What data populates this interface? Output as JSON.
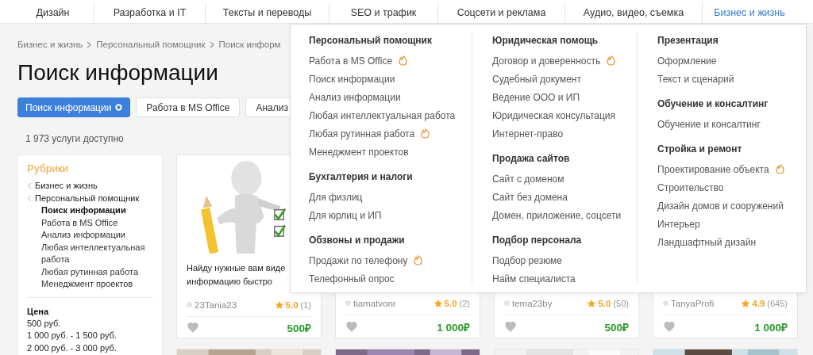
{
  "nav": [
    {
      "label": "Дизайн",
      "selected": false
    },
    {
      "label": "Разработка и IT",
      "selected": false
    },
    {
      "label": "Тексты и переводы",
      "selected": false
    },
    {
      "label": "SEO и трафик",
      "selected": false
    },
    {
      "label": "Соцсети и реклама",
      "selected": false
    },
    {
      "label": "Аудио, видео, съемка",
      "selected": false
    },
    {
      "label": "Бизнес и жизнь",
      "selected": true
    }
  ],
  "breadcrumb": [
    "Бизнес и жизнь",
    "Персональный помощник",
    "Поиск информ"
  ],
  "title": "Поиск информации",
  "chips": [
    {
      "label": "Поиск информации",
      "selected": true
    },
    {
      "label": "Работа в MS Office",
      "selected": false
    },
    {
      "label": "Анализ",
      "selected": false
    }
  ],
  "count": "1 973 услуги доступно",
  "sidebar": {
    "title": "Рубрики",
    "parents": [
      "Бизнес и жизнь",
      "Персональный помощник"
    ],
    "items": [
      {
        "label": "Поиск информации",
        "selected": true
      },
      {
        "label": "Работа в MS Office",
        "selected": false
      },
      {
        "label": "Анализ информации",
        "selected": false
      },
      {
        "label": "Любая интеллектуальная работа",
        "selected": false
      },
      {
        "label": "Любая рутинная работа",
        "selected": false
      },
      {
        "label": "Менеджмент проектов",
        "selected": false
      }
    ],
    "price_title": "Цена",
    "prices": [
      "500 руб.",
      "1 000 руб. - 1 500 руб.",
      "2 000 руб. - 3 000 руб."
    ]
  },
  "cards": [
    {
      "kind": "picture",
      "title": "Найду нужные вам виде",
      "subtitle": "информацию быстро",
      "seller": "23Tania23",
      "rating": "5.0",
      "reviews": "(1)",
      "price": "500₽"
    },
    {
      "seller": "tiamatvonr",
      "rating": "5.0",
      "reviews": "(2)",
      "price": "1 000₽"
    },
    {
      "seller": "tema23by",
      "rating": "5.0",
      "reviews": "(50)",
      "price": "500₽"
    },
    {
      "seller": "TanyaProfi",
      "rating": "4.9",
      "reviews": "(645)",
      "price": "1 000₽"
    }
  ],
  "more_cards": [
    {
      "kind": "picture"
    },
    {
      "kind": "picture"
    },
    {
      "kind": "picture"
    },
    {
      "kind": "picture"
    }
  ],
  "dropdown": [
    {
      "groups": [
        {
          "title": "Персональный помощник",
          "items": [
            {
              "label": "Работа в MS Office",
              "hot": true
            },
            {
              "label": "Поиск информации",
              "hot": false
            },
            {
              "label": "Анализ информации",
              "hot": false
            },
            {
              "label": "Любая интеллектуальная работа",
              "hot": false
            },
            {
              "label": "Любая рутинная работа",
              "hot": true
            },
            {
              "label": "Менеджмент проектов",
              "hot": false
            }
          ]
        },
        {
          "title": "Бухгалтерия и налоги",
          "items": [
            {
              "label": "Для физлиц",
              "hot": false
            },
            {
              "label": "Для юрлиц и ИП",
              "hot": false
            }
          ]
        },
        {
          "title": "Обзвоны и продажи",
          "items": [
            {
              "label": "Продажи по телефону",
              "hot": true
            },
            {
              "label": "Телефонный опрос",
              "hot": false
            }
          ]
        }
      ]
    },
    {
      "groups": [
        {
          "title": "Юридическая помощь",
          "items": [
            {
              "label": "Договор и доверенность",
              "hot": true
            },
            {
              "label": "Судебный документ",
              "hot": false
            },
            {
              "label": "Ведение ООО и ИП",
              "hot": false
            },
            {
              "label": "Юридическая консультация",
              "hot": false
            },
            {
              "label": "Интернет-право",
              "hot": false
            }
          ]
        },
        {
          "title": "Продажа сайтов",
          "items": [
            {
              "label": "Сайт с доменом",
              "hot": false
            },
            {
              "label": "Сайт без домена",
              "hot": false
            },
            {
              "label": "Домен, приложение, соцсети",
              "hot": false
            }
          ]
        },
        {
          "title": "Подбор персонала",
          "items": [
            {
              "label": "Подбор резюме",
              "hot": false
            },
            {
              "label": "Найм специалиста",
              "hot": false
            }
          ]
        }
      ]
    },
    {
      "groups": [
        {
          "title": "Презентация",
          "items": [
            {
              "label": "Оформление",
              "hot": false
            },
            {
              "label": "Текст и сценарий",
              "hot": false
            }
          ]
        },
        {
          "title": "Обучение и консалтинг",
          "items": [
            {
              "label": "Обучение и консалтинг",
              "hot": false
            }
          ]
        },
        {
          "title": "Стройка и ремонт",
          "items": [
            {
              "label": "Проектирование объекта",
              "hot": true
            },
            {
              "label": "Строительство",
              "hot": false
            },
            {
              "label": "Дизайн домов и сооружений",
              "hot": false
            },
            {
              "label": "Интерьер",
              "hot": false
            },
            {
              "label": "Ландшафтный дизайн",
              "hot": false
            }
          ]
        }
      ]
    }
  ]
}
